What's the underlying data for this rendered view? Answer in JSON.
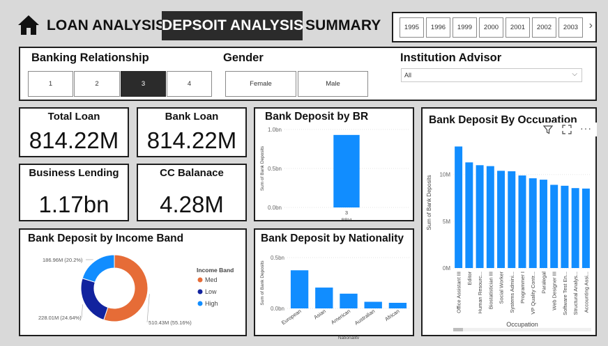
{
  "header": {
    "tabs": {
      "loan": "LOAN ANALYSIS",
      "deposit": "DEPSOIT ANALYSIS",
      "summary": "SUMMARY"
    },
    "years": [
      "1995",
      "1996",
      "1999",
      "2000",
      "2001",
      "2002",
      "2003"
    ],
    "next_arrow": "›"
  },
  "filters": {
    "banking_relationship": {
      "title": "Banking Relationship",
      "options": [
        "1",
        "2",
        "3",
        "4"
      ],
      "selected": "3"
    },
    "gender": {
      "title": "Gender",
      "options": [
        "Female",
        "Male"
      ]
    },
    "institution_advisor": {
      "title": "Institution Advisor",
      "value": "All"
    }
  },
  "kpis": {
    "total_loan": {
      "title": "Total Loan",
      "value": "814.22M"
    },
    "bank_loan": {
      "title": "Bank Loan",
      "value": "814.22M"
    },
    "business_lending": {
      "title": "Business Lending",
      "value": "1.17bn"
    },
    "cc_balance": {
      "title": "CC Balanace",
      "value": "4.28M"
    }
  },
  "chart_data": [
    {
      "id": "by_br",
      "type": "bar",
      "title": "Bank Deposit by BR",
      "ylabel": "Sum of Bank Deposits",
      "xlabel": "BRId",
      "yticks": [
        "0.0bn",
        "0.5bn",
        "1.0bn"
      ],
      "ylim": [
        0,
        1.0
      ],
      "categories": [
        "3"
      ],
      "values": [
        0.93
      ],
      "color": "#118DFF"
    },
    {
      "id": "by_occupation",
      "type": "bar",
      "title": "Bank Deposit By Occupation",
      "ylabel": "Sum of Bank Deposits",
      "xlabel": "Occupation",
      "yticks": [
        "0M",
        "5M",
        "10M"
      ],
      "ylim": [
        0,
        14
      ],
      "categories": [
        "Office Assistant III",
        "Editor",
        "Human Resourc...",
        "Biostatistician III",
        "Social Worker",
        "Systems Admini...",
        "Programmer I",
        "VP Quality Contr...",
        "Paralegal",
        "Web Designer III",
        "Software Test En...",
        "Structural Analys...",
        "Accounting Assi..."
      ],
      "values": [
        13.0,
        11.3,
        11.0,
        10.9,
        10.4,
        10.35,
        9.9,
        9.6,
        9.45,
        8.9,
        8.8,
        8.55,
        8.5
      ],
      "color": "#118DFF"
    },
    {
      "id": "by_income_band",
      "type": "pie",
      "title": "Bank Deposit by Income Band",
      "legend_title": "Income Band",
      "slices": [
        {
          "name": "Med",
          "value": 510.43,
          "label": "510.43M (55.16%)",
          "color": "#E66C37"
        },
        {
          "name": "Low",
          "value": 228.01,
          "label": "228.01M (24.64%)",
          "color": "#12239E"
        },
        {
          "name": "High",
          "value": 186.96,
          "label": "186.96M (20.2%)",
          "color": "#118DFF"
        }
      ]
    },
    {
      "id": "by_nationality",
      "type": "bar",
      "title": "Bank Deposit by Nationality",
      "ylabel": "Sum of Bank Deposits",
      "xlabel": "Nationality",
      "yticks": [
        "0.0bn",
        "0.5bn"
      ],
      "ylim": [
        0,
        0.5
      ],
      "categories": [
        "European",
        "Asian",
        "American",
        "Australian",
        "African"
      ],
      "values": [
        0.375,
        0.205,
        0.145,
        0.065,
        0.055
      ],
      "color": "#118DFF"
    }
  ]
}
